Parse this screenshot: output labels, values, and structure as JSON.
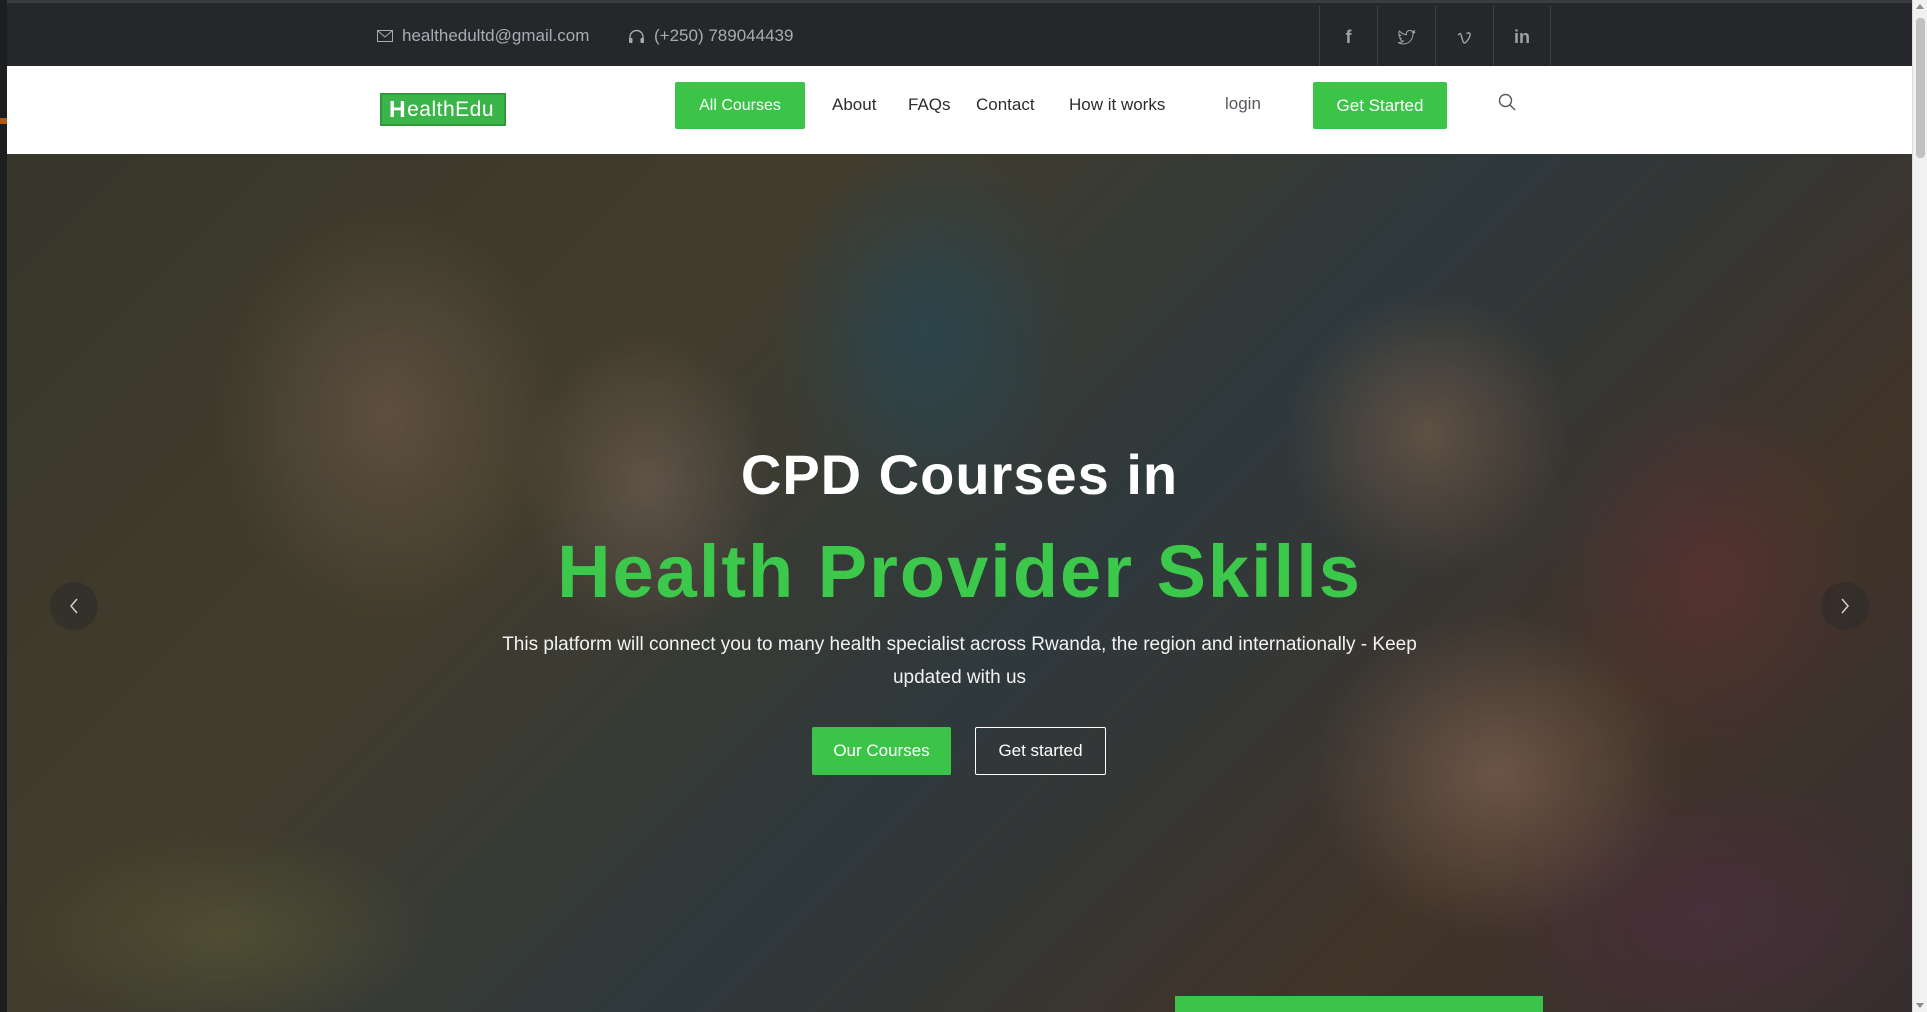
{
  "topbar": {
    "email": "healthedultd@gmail.com",
    "phone": "(+250) 789044439",
    "social": [
      {
        "icon": "facebook-icon",
        "glyph": "f"
      },
      {
        "icon": "twitter-icon",
        "glyph": "t"
      },
      {
        "icon": "vimeo-icon",
        "glyph": "v"
      },
      {
        "icon": "linkedin-icon",
        "glyph": "in"
      }
    ]
  },
  "nav": {
    "logo_first": "H",
    "logo_rest": "ealthEdu",
    "all_courses": "All Courses",
    "about": "About",
    "faqs": "FAQs",
    "contact": "Contact",
    "how_it_works": "How it works",
    "login": "login",
    "get_started": "Get Started"
  },
  "hero": {
    "title": "CPD Courses in",
    "subtitle": "Health Provider Skills",
    "description": "This platform will connect you to many health specialist across Rwanda, the region and internationally - Keep updated with us",
    "btn_courses": "Our Courses",
    "btn_started": "Get started"
  },
  "colors": {
    "brand_green": "#3bc447",
    "topbar_bg": "#25272a"
  }
}
